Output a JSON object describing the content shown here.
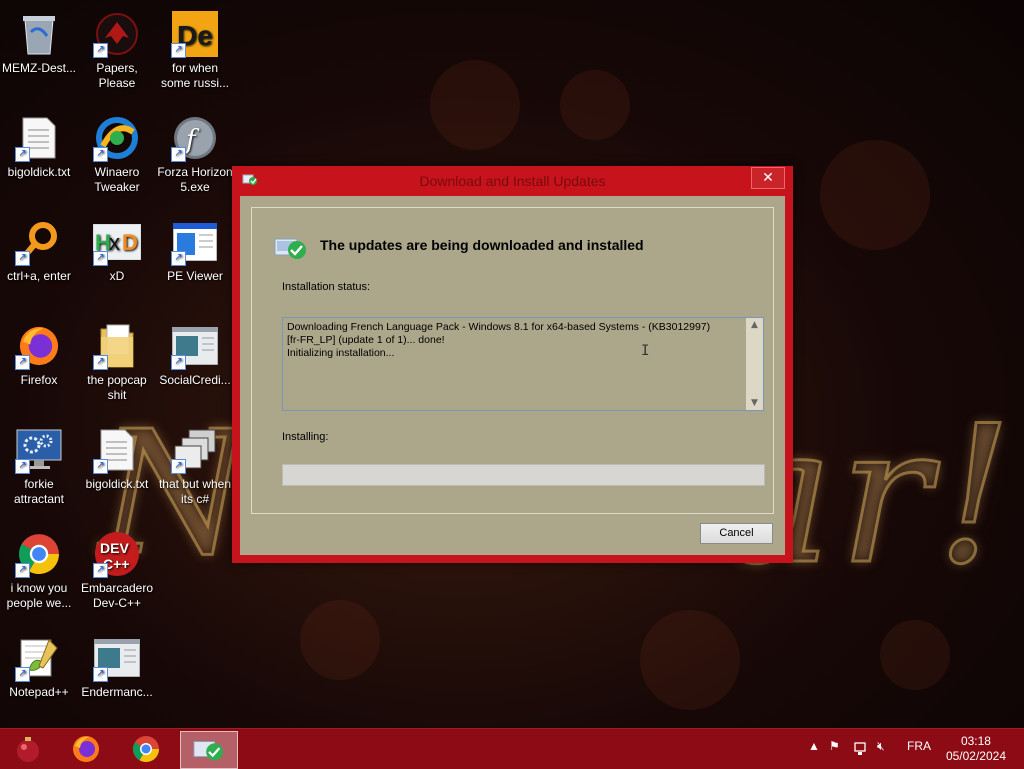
{
  "desktop": {
    "icons": [
      {
        "label": "MEMZ-Dest...",
        "icon": "recycle-bin-icon"
      },
      {
        "label": "Papers, Please",
        "icon": "papers-please-icon"
      },
      {
        "label": "for when some russi...",
        "icon": "de-icon"
      },
      {
        "label": "bigoldick.txt",
        "icon": "text-file-icon"
      },
      {
        "label": "Winaero Tweaker",
        "icon": "winaero-icon"
      },
      {
        "label": "Forza Horizon 5.exe",
        "icon": "flash-icon"
      },
      {
        "label": "ctrl+a, enter",
        "icon": "magnifier-ring-icon"
      },
      {
        "label": "xD",
        "icon": "hxd-icon"
      },
      {
        "label": "PE Viewer",
        "icon": "pe-viewer-icon"
      },
      {
        "label": "Firefox",
        "icon": "firefox-icon"
      },
      {
        "label": "the popcap shit",
        "icon": "folder-icon"
      },
      {
        "label": "SocialCredi...",
        "icon": "app-window-icon"
      },
      {
        "label": "forkie attractant",
        "icon": "monitor-gears-icon"
      },
      {
        "label": "bigoldick.txt",
        "icon": "text-file-icon"
      },
      {
        "label": "that but when its c#",
        "icon": "stacked-windows-icon"
      },
      {
        "label": "i know you people we...",
        "icon": "chrome-icon"
      },
      {
        "label": "Embarcadero Dev-C++",
        "icon": "devcpp-icon"
      },
      {
        "label": "Notepad++",
        "icon": "notepadpp-icon"
      },
      {
        "label": "Endermanc...",
        "icon": "app-window-icon"
      }
    ]
  },
  "dialog": {
    "title": "Download and Install Updates",
    "close_glyph": "✕",
    "heading": "The updates are being downloaded and installed",
    "status_label": "Installation status:",
    "status_text": "Downloading French Language Pack - Windows 8.1 for x64-based Systems - (KB3012997)\n[fr-FR_LP] (update 1 of 1)... done!\nInitializing installation...",
    "progress_label": "Installing:",
    "progress_fraction": 0,
    "cancel_label": "Cancel"
  },
  "taskbar": {
    "items": [
      {
        "name": "start-ornament-icon",
        "active": false
      },
      {
        "name": "firefox-icon",
        "active": false
      },
      {
        "name": "chrome-icon",
        "active": false
      },
      {
        "name": "windows-update-icon",
        "active": true
      }
    ],
    "language": "FRA",
    "time": "03:18",
    "date": "05/02/2024"
  },
  "colors": {
    "accent": "#c7141c",
    "taskbar": "#8c0b14",
    "dialog_body": "#aca68b"
  }
}
